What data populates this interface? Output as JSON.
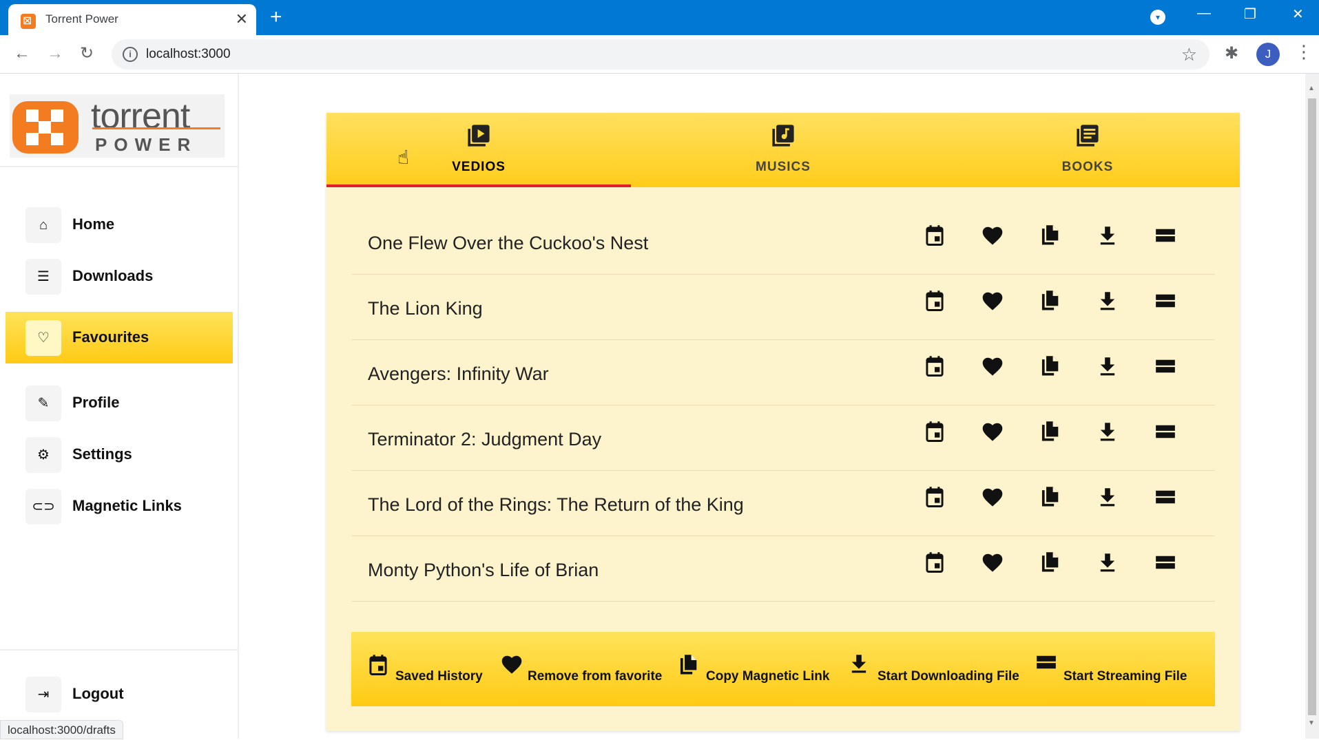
{
  "browser": {
    "tab_title": "Torrent Power",
    "tab_close": "✕",
    "new_tab": "+",
    "url": "localhost:3000",
    "avatar_letter": "J",
    "status_url": "localhost:3000/drafts"
  },
  "logo": {
    "word": "torrent",
    "sub": "POWER"
  },
  "sidebar": {
    "items": [
      {
        "label": "Home",
        "icon": "home-icon",
        "glyph": "⌂",
        "active": false
      },
      {
        "label": "Downloads",
        "icon": "list-icon",
        "glyph": "☰",
        "active": false
      },
      {
        "label": "Favourites",
        "icon": "heart-outline-icon",
        "glyph": "♡",
        "active": true
      },
      {
        "label": "Profile",
        "icon": "pencil-icon",
        "glyph": "✎",
        "active": false
      },
      {
        "label": "Settings",
        "icon": "gear-icon",
        "glyph": "⚙",
        "active": false
      },
      {
        "label": "Magnetic Links",
        "icon": "link-icon",
        "glyph": "⊂⊃",
        "active": false
      }
    ],
    "logout": {
      "label": "Logout",
      "icon": "logout-icon",
      "glyph": "⇥"
    }
  },
  "tabs": [
    {
      "label": "VEDIOS",
      "icon": "video-library-icon",
      "selected": true
    },
    {
      "label": "MUSICS",
      "icon": "music-library-icon",
      "selected": false
    },
    {
      "label": "BOOKS",
      "icon": "books-library-icon",
      "selected": false
    }
  ],
  "items": [
    "One Flew Over the Cuckoo's Nest",
    "The Lion King",
    "Avengers: Infinity War",
    "Terminator 2: Judgment Day",
    "The Lord of the Rings: The Return of the King",
    "Monty Python's Life of Brian"
  ],
  "row_actions": [
    "calendar-icon",
    "heart-icon",
    "copy-icon",
    "download-icon",
    "stream-icon"
  ],
  "legend": [
    {
      "icon": "calendar-icon",
      "label": "Saved History"
    },
    {
      "icon": "heart-icon",
      "label": "Remove from favorite"
    },
    {
      "icon": "copy-icon",
      "label": "Copy Magnetic Link"
    },
    {
      "icon": "download-icon",
      "label": "Start Downloading File"
    },
    {
      "icon": "stream-icon",
      "label": "Start Streaming File"
    }
  ]
}
